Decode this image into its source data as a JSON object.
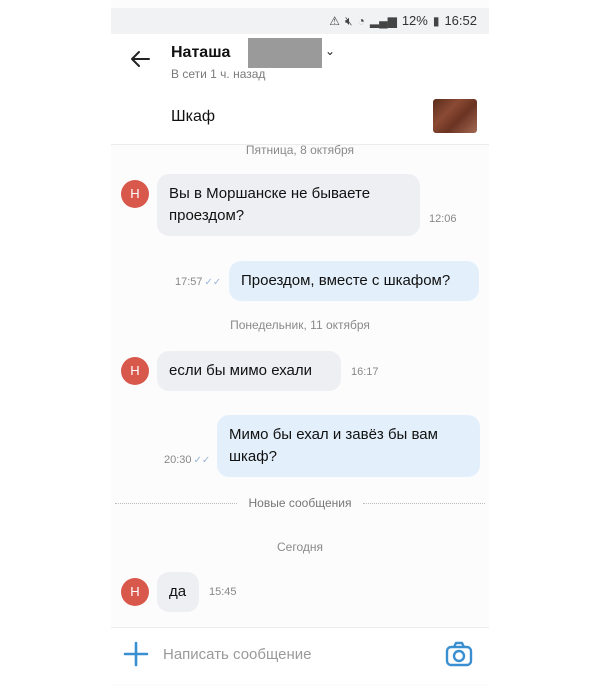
{
  "status_bar": {
    "battery": "12%",
    "time": "16:52"
  },
  "header": {
    "contact_name": "Наташа",
    "contact_status": "В сети 1 ч. назад"
  },
  "listing": {
    "title": "Шкаф"
  },
  "messages": [
    {
      "type": "date",
      "text": "Пятница, 8 октября"
    },
    {
      "type": "in",
      "avatar": "Н",
      "text": "Вы в Моршанске не бываете проездом?",
      "time": "12:06"
    },
    {
      "type": "out",
      "text": "Проездом, вместе с шкафом?",
      "time": "17:57"
    },
    {
      "type": "date",
      "text": "Понедельник, 11 октября"
    },
    {
      "type": "in",
      "avatar": "Н",
      "text": "если бы мимо ехали",
      "time": "16:17"
    },
    {
      "type": "out",
      "text": "Мимо бы ехал и завёз бы вам шкаф?",
      "time": "20:30"
    },
    {
      "type": "divider",
      "text": "Новые сообщения"
    },
    {
      "type": "date",
      "text": "Сегодня"
    },
    {
      "type": "in",
      "avatar": "Н",
      "text": "да",
      "time": "15:45"
    }
  ],
  "composer": {
    "placeholder": "Написать сообщение"
  },
  "colors": {
    "avatar_bg": "#d9584c",
    "incoming_bubble": "#eeeff2",
    "outgoing_bubble": "#e3f0fb",
    "accent": "#3a8fd0"
  },
  "icons": [
    "back-arrow-icon",
    "chevron-down-icon",
    "plus-icon",
    "camera-icon",
    "read-checks-icon",
    "wifi-icon",
    "signal-icon",
    "battery-icon",
    "mute-icon"
  ]
}
